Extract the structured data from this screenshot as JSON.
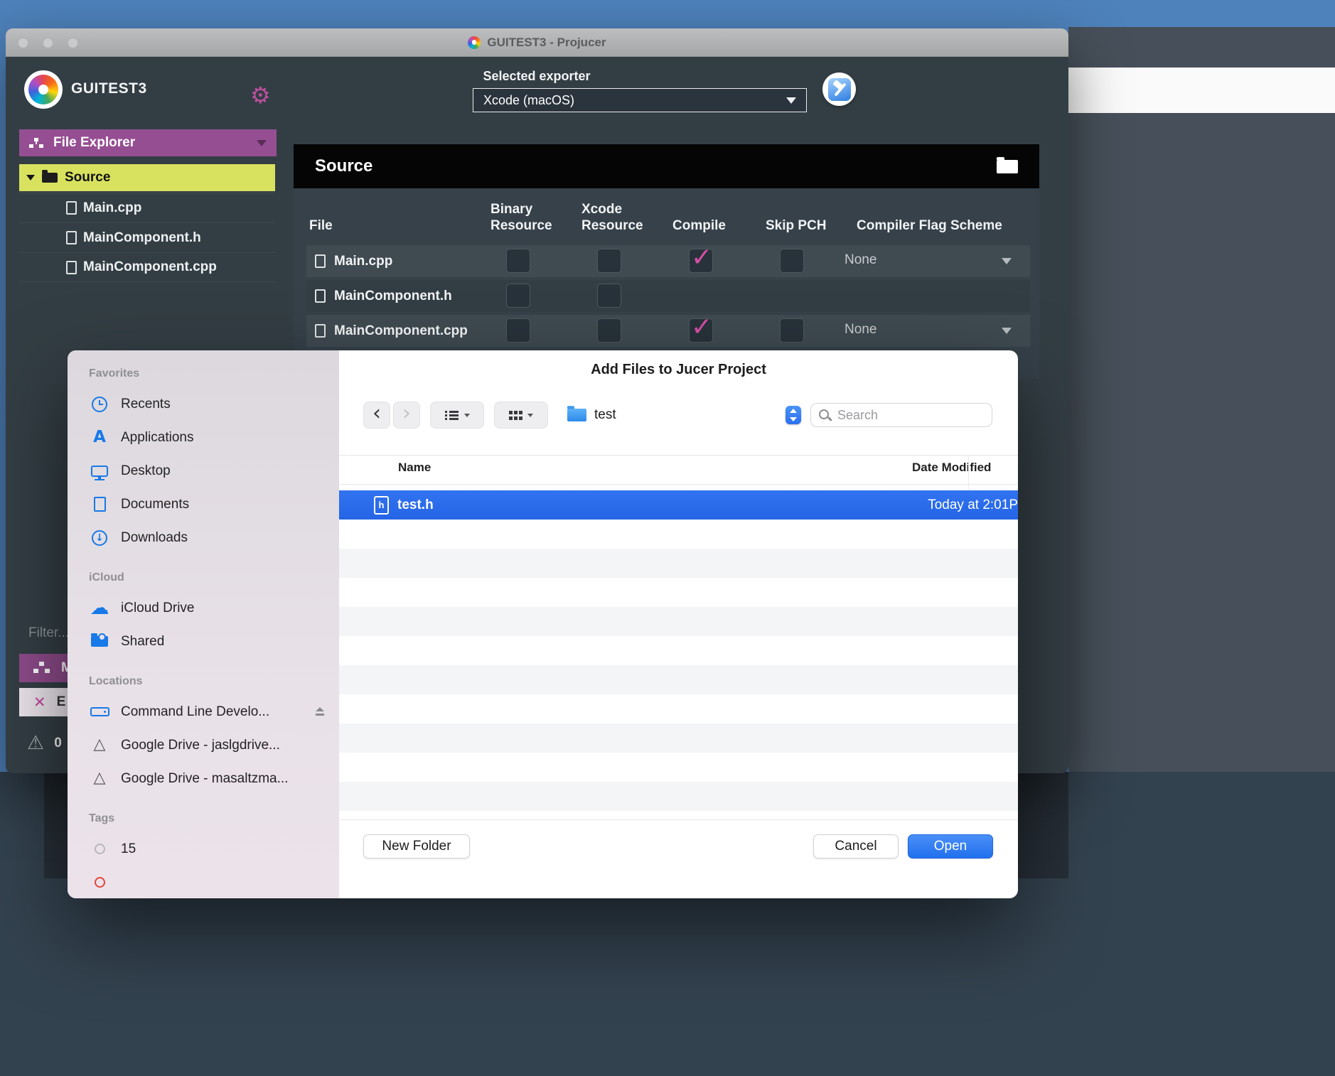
{
  "colors": {
    "accent_pink": "#d44fa6",
    "source_highlight": "#d8e25f",
    "header_purple": "#954e92",
    "selection_blue": "#2a6df0",
    "open_button_blue": "#2e7bf1"
  },
  "window": {
    "title": "GUITEST3 - Projucer"
  },
  "projucer": {
    "app_name": "GUITEST3",
    "selected_exporter_label": "Selected exporter",
    "exporter_value": "Xcode (macOS)",
    "file_explorer_label": "File Explorer",
    "tree_root": "Source",
    "tree_files": [
      "Main.cpp",
      "MainComponent.h",
      "MainComponent.cpp"
    ],
    "filter_placeholder": "Filter...",
    "panel_m": "M",
    "panel_e": "E",
    "warning_count": "0",
    "source_panel": {
      "title": "Source",
      "col_file": "File",
      "col_binary": "Binary Resource",
      "col_xcode": "Xcode Resource",
      "col_compile": "Compile",
      "col_skip": "Skip PCH",
      "col_flags": "Compiler Flag Scheme",
      "rows": [
        {
          "file": "Main.cpp",
          "binary": "",
          "xcode": "",
          "compile": "✓",
          "skip": "",
          "flags": "None"
        },
        {
          "file": "MainComponent.h",
          "binary": "",
          "xcode": ""
        },
        {
          "file": "MainComponent.cpp",
          "binary": "",
          "xcode": "",
          "compile": "✓",
          "skip": "",
          "flags": "None"
        }
      ]
    }
  },
  "dialog": {
    "title": "Add Files to Jucer Project",
    "folder_value": "test",
    "search_placeholder": "Search",
    "col_name": "Name",
    "col_date": "Date Modified",
    "selected_file": {
      "badge": "h",
      "name": "test.h",
      "date": "Today at 2:01P"
    },
    "new_folder": "New Folder",
    "cancel": "Cancel",
    "open": "Open",
    "sidebar": {
      "favorites_heading": "Favorites",
      "favorites": [
        "Recents",
        "Applications",
        "Desktop",
        "Documents",
        "Downloads"
      ],
      "icloud_heading": "iCloud",
      "icloud": [
        "iCloud Drive",
        "Shared"
      ],
      "locations_heading": "Locations",
      "locations": [
        "Command Line Develo...",
        "Google Drive - jaslgdrive...",
        "Google Drive - masaltzma..."
      ],
      "tags_heading": "Tags",
      "tags": [
        "15"
      ]
    }
  }
}
